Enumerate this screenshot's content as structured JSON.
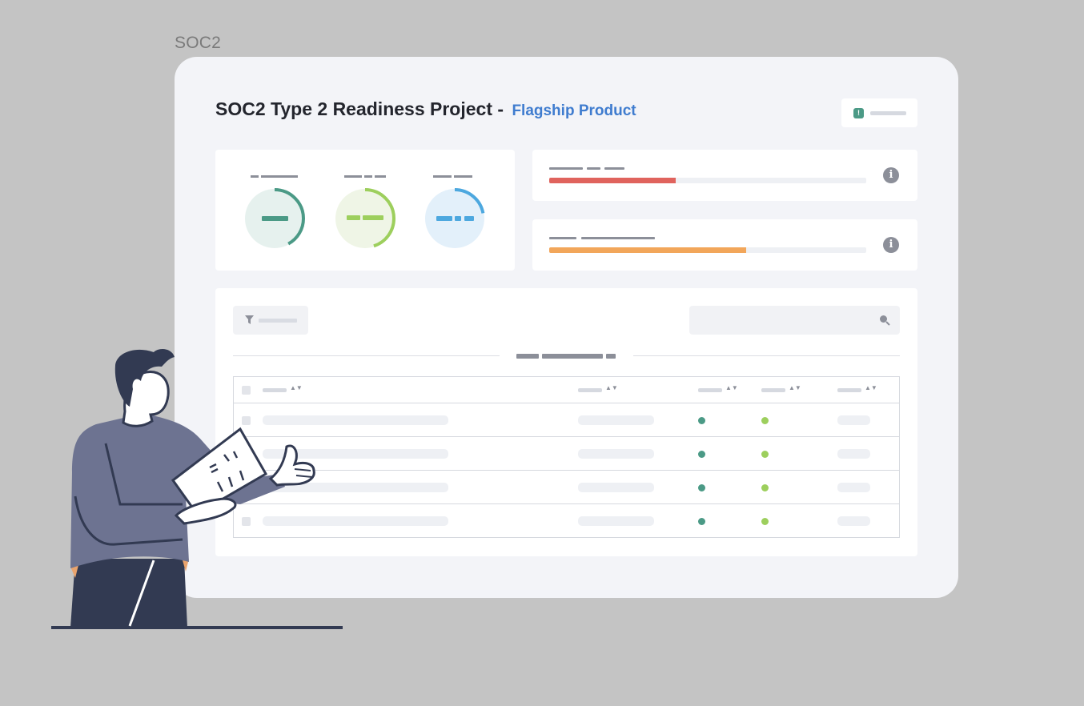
{
  "frame_label": "SOC2",
  "header": {
    "title": "SOC2 Type 2 Readiness Project - ",
    "subtitle": "Flagship Product"
  },
  "badge": {
    "icon": "alert-icon",
    "icon_glyph": "!",
    "color": "#4b9a86"
  },
  "gauges": [
    {
      "color": "#4b9a86",
      "bg": "#e6f1ee",
      "progress": 0.42
    },
    {
      "color": "#9dcf5d",
      "bg": "#eff5e6",
      "progress": 0.45
    },
    {
      "color": "#4da8df",
      "bg": "#e3f0fa",
      "progress": 0.22
    }
  ],
  "progress_bars": [
    {
      "color": "#e0635d",
      "progress": 0.4,
      "info_glyph": "i"
    },
    {
      "color": "#f2a65a",
      "progress": 0.62,
      "info_glyph": "i"
    }
  ],
  "table": {
    "rows": [
      {
        "status_a": "#4b9a86",
        "status_b": "#9dcf5d"
      },
      {
        "status_a": "#4b9a86",
        "status_b": "#9dcf5d"
      },
      {
        "status_a": "#4b9a86",
        "status_b": "#9dcf5d"
      },
      {
        "status_a": "#4b9a86",
        "status_b": "#9dcf5d"
      }
    ]
  },
  "sort_glyph": "▲▼"
}
